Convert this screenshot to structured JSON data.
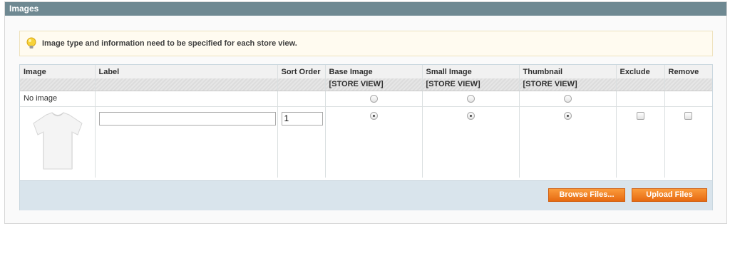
{
  "panel": {
    "title": "Images"
  },
  "notice": {
    "text": "Image type and information need to be specified for each store view."
  },
  "grid": {
    "columns": [
      {
        "label": "Image",
        "scope": ""
      },
      {
        "label": "Label",
        "scope": ""
      },
      {
        "label": "Sort Order",
        "scope": ""
      },
      {
        "label": "Base Image",
        "scope": "[STORE VIEW]"
      },
      {
        "label": "Small Image",
        "scope": "[STORE VIEW]"
      },
      {
        "label": "Thumbnail",
        "scope": "[STORE VIEW]"
      },
      {
        "label": "Exclude",
        "scope": ""
      },
      {
        "label": "Remove",
        "scope": ""
      }
    ],
    "no_image_row": {
      "label": "No image",
      "base": false,
      "small": false,
      "thumbnail": false
    },
    "image_row": {
      "image_icon": "tshirt-image",
      "label_value": "",
      "sort_order": "1",
      "base": true,
      "small": true,
      "thumbnail": true,
      "exclude": false,
      "remove": false
    }
  },
  "buttons": {
    "browse": "Browse Files...",
    "upload": "Upload Files"
  },
  "colors": {
    "header_bg": "#6f8992",
    "button_orange": "#f18326",
    "footer_bg": "#d9e4ec",
    "notice_bg": "#fffbf0"
  }
}
